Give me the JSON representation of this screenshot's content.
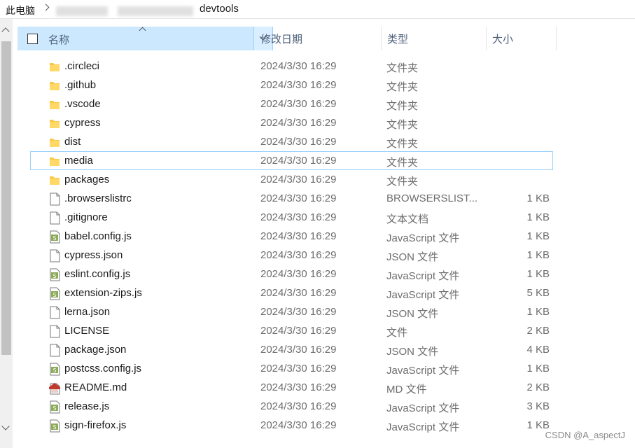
{
  "breadcrumb": {
    "root": "此电脑",
    "current": "devtools"
  },
  "header": {
    "name": "名称",
    "date": "修改日期",
    "type": "类型",
    "size": "大小"
  },
  "colors": {
    "folder": "#f8c74a",
    "header_selected": "#cce8ff",
    "focus_border": "#99d1ff",
    "js_icon": "#7a9c3d",
    "md_icon": "#c0392b"
  },
  "files": [
    {
      "name": ".circleci",
      "date": "2024/3/30 16:29",
      "type": "文件夹",
      "size": "",
      "icon": "folder-icon"
    },
    {
      "name": ".github",
      "date": "2024/3/30 16:29",
      "type": "文件夹",
      "size": "",
      "icon": "folder-icon"
    },
    {
      "name": ".vscode",
      "date": "2024/3/30 16:29",
      "type": "文件夹",
      "size": "",
      "icon": "folder-icon"
    },
    {
      "name": "cypress",
      "date": "2024/3/30 16:29",
      "type": "文件夹",
      "size": "",
      "icon": "folder-icon"
    },
    {
      "name": "dist",
      "date": "2024/3/30 16:29",
      "type": "文件夹",
      "size": "",
      "icon": "folder-icon"
    },
    {
      "name": "media",
      "date": "2024/3/30 16:29",
      "type": "文件夹",
      "size": "",
      "icon": "folder-icon"
    },
    {
      "name": "packages",
      "date": "2024/3/30 16:29",
      "type": "文件夹",
      "size": "",
      "icon": "folder-icon"
    },
    {
      "name": ".browserslistrc",
      "date": "2024/3/30 16:29",
      "type": "BROWSERSLIST...",
      "size": "1 KB",
      "icon": "file-icon"
    },
    {
      "name": ".gitignore",
      "date": "2024/3/30 16:29",
      "type": "文本文档",
      "size": "1 KB",
      "icon": "file-icon"
    },
    {
      "name": "babel.config.js",
      "date": "2024/3/30 16:29",
      "type": "JavaScript 文件",
      "size": "1 KB",
      "icon": "js-file-icon"
    },
    {
      "name": "cypress.json",
      "date": "2024/3/30 16:29",
      "type": "JSON 文件",
      "size": "1 KB",
      "icon": "file-icon"
    },
    {
      "name": "eslint.config.js",
      "date": "2024/3/30 16:29",
      "type": "JavaScript 文件",
      "size": "1 KB",
      "icon": "js-file-icon"
    },
    {
      "name": "extension-zips.js",
      "date": "2024/3/30 16:29",
      "type": "JavaScript 文件",
      "size": "5 KB",
      "icon": "js-file-icon"
    },
    {
      "name": "lerna.json",
      "date": "2024/3/30 16:29",
      "type": "JSON 文件",
      "size": "1 KB",
      "icon": "file-icon"
    },
    {
      "name": "LICENSE",
      "date": "2024/3/30 16:29",
      "type": "文件",
      "size": "2 KB",
      "icon": "file-icon"
    },
    {
      "name": "package.json",
      "date": "2024/3/30 16:29",
      "type": "JSON 文件",
      "size": "4 KB",
      "icon": "file-icon"
    },
    {
      "name": "postcss.config.js",
      "date": "2024/3/30 16:29",
      "type": "JavaScript 文件",
      "size": "1 KB",
      "icon": "js-file-icon"
    },
    {
      "name": "README.md",
      "date": "2024/3/30 16:29",
      "type": "MD 文件",
      "size": "2 KB",
      "icon": "md-file-icon"
    },
    {
      "name": "release.js",
      "date": "2024/3/30 16:29",
      "type": "JavaScript 文件",
      "size": "3 KB",
      "icon": "js-file-icon"
    },
    {
      "name": "sign-firefox.js",
      "date": "2024/3/30 16:29",
      "type": "JavaScript 文件",
      "size": "1 KB",
      "icon": "js-file-icon"
    }
  ],
  "focused_row": "media",
  "watermark": "CSDN @A_aspectJ"
}
